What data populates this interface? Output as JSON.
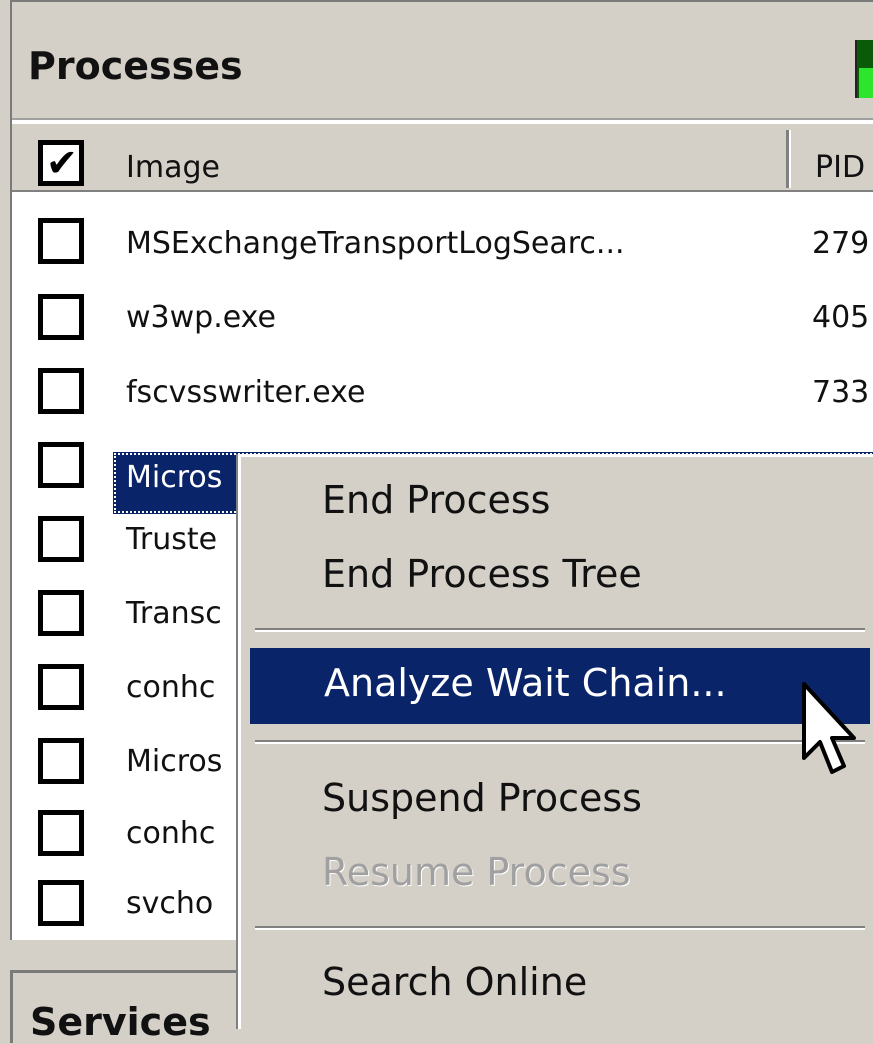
{
  "panel": {
    "title": "Processes"
  },
  "columns": {
    "image": "Image",
    "pid": "PID"
  },
  "rows": [
    {
      "image": "MSExchangeTransportLogSearc...",
      "pid": "279"
    },
    {
      "image": "w3wp.exe",
      "pid": "405"
    },
    {
      "image": "fscvsswriter.exe",
      "pid": "733"
    },
    {
      "image": "Micros",
      "pid": ""
    },
    {
      "image": "Truste",
      "pid": ""
    },
    {
      "image": "Transc",
      "pid": ""
    },
    {
      "image": "conhc",
      "pid": ""
    },
    {
      "image": "Micros",
      "pid": ""
    },
    {
      "image": "conhc",
      "pid": ""
    },
    {
      "image": "svcho",
      "pid": ""
    }
  ],
  "context_menu": {
    "end_process": "End Process",
    "end_process_tree": "End Process Tree",
    "analyze_wait_chain": "Analyze Wait Chain...",
    "suspend_process": "Suspend Process",
    "resume_process": "Resume Process",
    "search_online": "Search Online"
  },
  "services_panel": {
    "title": "Services"
  },
  "colors": {
    "selection": "#0a246a",
    "chrome": "#d4d0c8",
    "cpu_graph": "#2ee52e"
  }
}
